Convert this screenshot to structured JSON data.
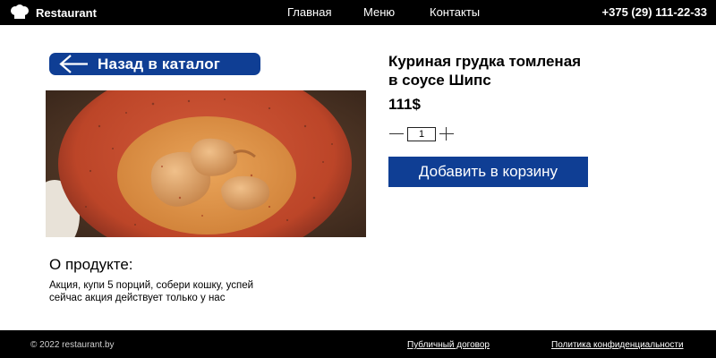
{
  "header": {
    "logo_text": "Restaurant",
    "logo_icon": "chef-hat-icon",
    "nav": [
      {
        "label": "Главная"
      },
      {
        "label": "Меню"
      },
      {
        "label": "Контакты"
      }
    ],
    "phone": "+375 (29) 111-22-33"
  },
  "back_button": {
    "label": "Назад в каталог",
    "icon": "arrow-left-icon"
  },
  "product": {
    "title_line1": "Куриная грудка томленая",
    "title_line2": "в соусе Шипс",
    "price": "111$",
    "quantity": "1",
    "add_to_cart_label": "Добавить в корзину"
  },
  "about": {
    "heading": "О продукте:",
    "text_line1": "Акция, купи 5 порций, собери кошку, успей",
    "text_line2": "сейчас акция действует только у нас"
  },
  "footer": {
    "copyright": "© 2022 restaurant.by",
    "links": [
      {
        "label": "Публичный договор"
      },
      {
        "label": "Политика конфиденциальности"
      }
    ]
  },
  "colors": {
    "header_bg": "#000000",
    "accent_blue": "#0f3e94",
    "plate_red": "#c24a30",
    "sauce_orange": "#de9046"
  }
}
